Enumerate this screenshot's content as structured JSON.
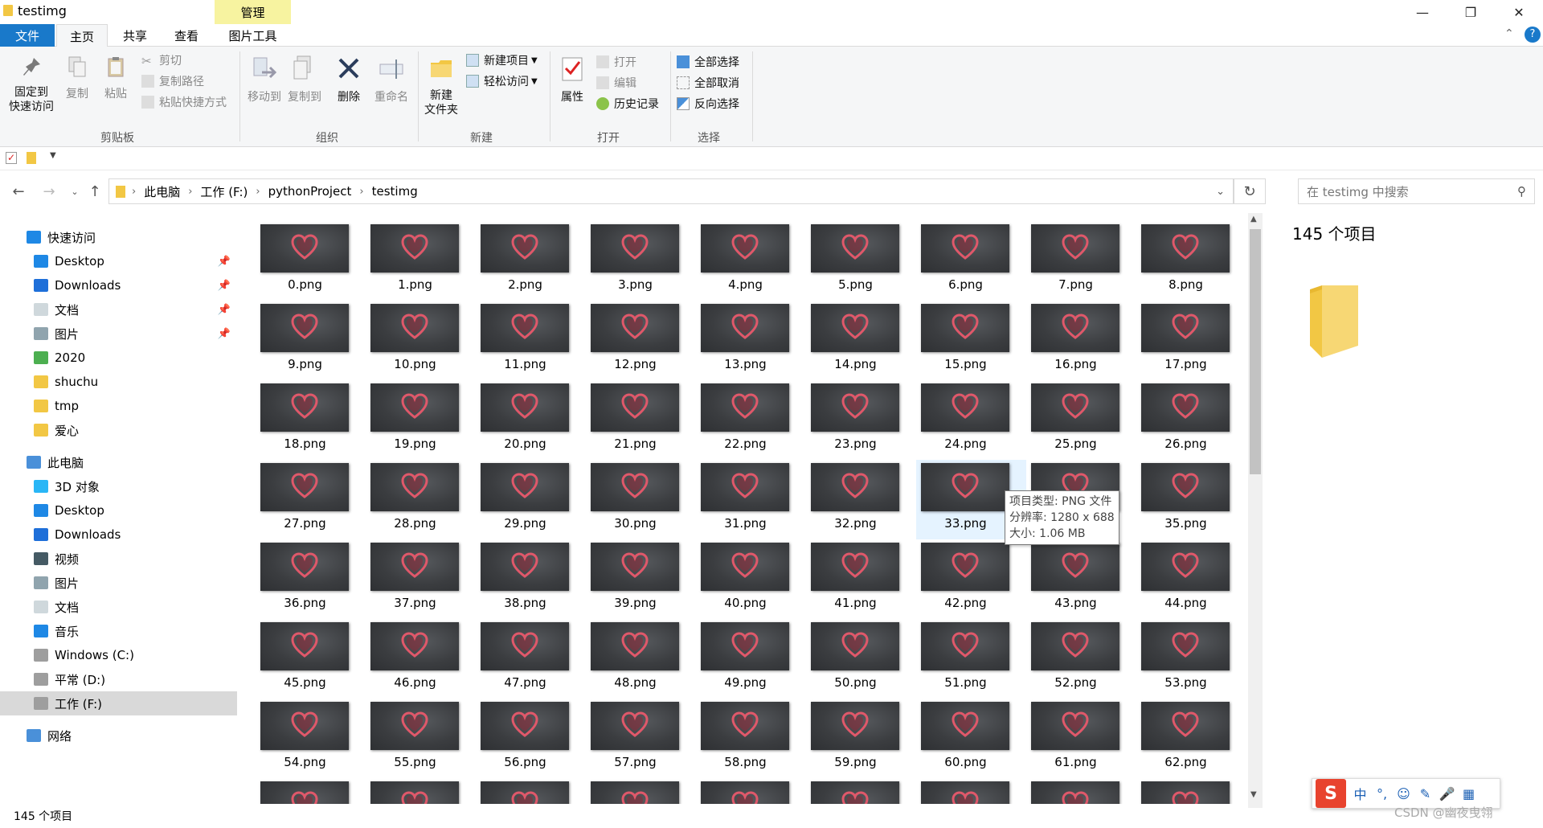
{
  "window": {
    "title": "testimg",
    "minimize_icon": "minimize-icon",
    "maximize_icon": "restore-icon",
    "close_icon": "close-icon",
    "collapse_icon": "chevron-up-icon",
    "help_icon": "help-icon"
  },
  "contextual_tab": "管理",
  "tabs": [
    "文件",
    "主页",
    "共享",
    "查看",
    "图片工具"
  ],
  "ribbon": {
    "clipboard": {
      "label": "剪贴板",
      "pin": "固定到\n快速访问",
      "copy": "复制",
      "paste": "粘贴",
      "cut": "剪切",
      "copy_path": "复制路径",
      "paste_shortcut": "粘贴快捷方式"
    },
    "organize": {
      "label": "组织",
      "move_to": "移动到",
      "copy_to": "复制到",
      "delete": "删除",
      "rename": "重命名"
    },
    "new": {
      "label": "新建",
      "new_folder": "新建\n文件夹",
      "new_item": "新建项目",
      "easy_access": "轻松访问"
    },
    "open": {
      "label": "打开",
      "properties": "属性",
      "open": "打开",
      "edit": "编辑",
      "history": "历史记录"
    },
    "select": {
      "label": "选择",
      "select_all": "全部选择",
      "select_none": "全部取消",
      "invert": "反向选择"
    }
  },
  "address": {
    "crumbs": [
      "此电脑",
      "工作 (F:)",
      "pythonProject",
      "testimg"
    ]
  },
  "search": {
    "placeholder": "在 testimg 中搜索"
  },
  "nav": {
    "quick_access": "快速访问",
    "quick_items": [
      {
        "label": "Desktop",
        "icon": "desktop-icon",
        "pinned": true
      },
      {
        "label": "Downloads",
        "icon": "download-icon",
        "pinned": true
      },
      {
        "label": "文档",
        "icon": "document-icon",
        "pinned": true
      },
      {
        "label": "图片",
        "icon": "picture-icon",
        "pinned": true
      },
      {
        "label": "2020",
        "icon": "folder-sync-icon",
        "pinned": false
      },
      {
        "label": "shuchu",
        "icon": "folder-icon",
        "pinned": false
      },
      {
        "label": "tmp",
        "icon": "folder-icon",
        "pinned": false
      },
      {
        "label": "爱心",
        "icon": "folder-icon",
        "pinned": false
      }
    ],
    "this_pc": "此电脑",
    "pc_items": [
      {
        "label": "3D 对象",
        "icon": "3d-objects-icon"
      },
      {
        "label": "Desktop",
        "icon": "desktop-icon"
      },
      {
        "label": "Downloads",
        "icon": "download-icon"
      },
      {
        "label": "视频",
        "icon": "video-icon"
      },
      {
        "label": "图片",
        "icon": "picture-icon"
      },
      {
        "label": "文档",
        "icon": "document-icon"
      },
      {
        "label": "音乐",
        "icon": "music-icon"
      },
      {
        "label": "Windows (C:)",
        "icon": "drive-icon"
      },
      {
        "label": "平常 (D:)",
        "icon": "drive-icon"
      },
      {
        "label": "工作 (F:)",
        "icon": "drive-icon",
        "selected": true
      }
    ],
    "network": "网络"
  },
  "files": [
    "0.png",
    "1.png",
    "2.png",
    "3.png",
    "4.png",
    "5.png",
    "6.png",
    "7.png",
    "8.png",
    "9.png",
    "10.png",
    "11.png",
    "12.png",
    "13.png",
    "14.png",
    "15.png",
    "16.png",
    "17.png",
    "18.png",
    "19.png",
    "20.png",
    "21.png",
    "22.png",
    "23.png",
    "24.png",
    "25.png",
    "26.png",
    "27.png",
    "28.png",
    "29.png",
    "30.png",
    "31.png",
    "32.png",
    "33.png",
    "34.png",
    "35.png",
    "36.png",
    "37.png",
    "38.png",
    "39.png",
    "40.png",
    "41.png",
    "42.png",
    "43.png",
    "44.png",
    "45.png",
    "46.png",
    "47.png",
    "48.png",
    "49.png",
    "50.png",
    "51.png",
    "52.png",
    "53.png",
    "54.png",
    "55.png",
    "56.png",
    "57.png",
    "58.png",
    "59.png",
    "60.png",
    "61.png",
    "62.png"
  ],
  "hovered_file": "33.png",
  "tooltip": {
    "type": "项目类型: PNG 文件",
    "resolution": "分辨率: 1280 x 688",
    "size": "大小: 1.06 MB"
  },
  "preview": {
    "count": "145 个项目"
  },
  "status": {
    "count": "145 个项目"
  },
  "ime": {
    "logo": "S",
    "mode": "中",
    "punct": "°,",
    "emoji_icon": "smiley-icon",
    "skin_icon": "brush-icon",
    "voice_icon": "microphone-icon",
    "toolbox_icon": "grid-icon"
  },
  "watermark": "CSDN @幽夜曳翎",
  "colors": {
    "file_tab": "#1979ca",
    "context_tab": "#f7f3a0",
    "selected_nav": "#d9d9d9",
    "hover_tile": "#e5f3ff",
    "folder": "#f2c744",
    "heart": "#e0586a"
  }
}
